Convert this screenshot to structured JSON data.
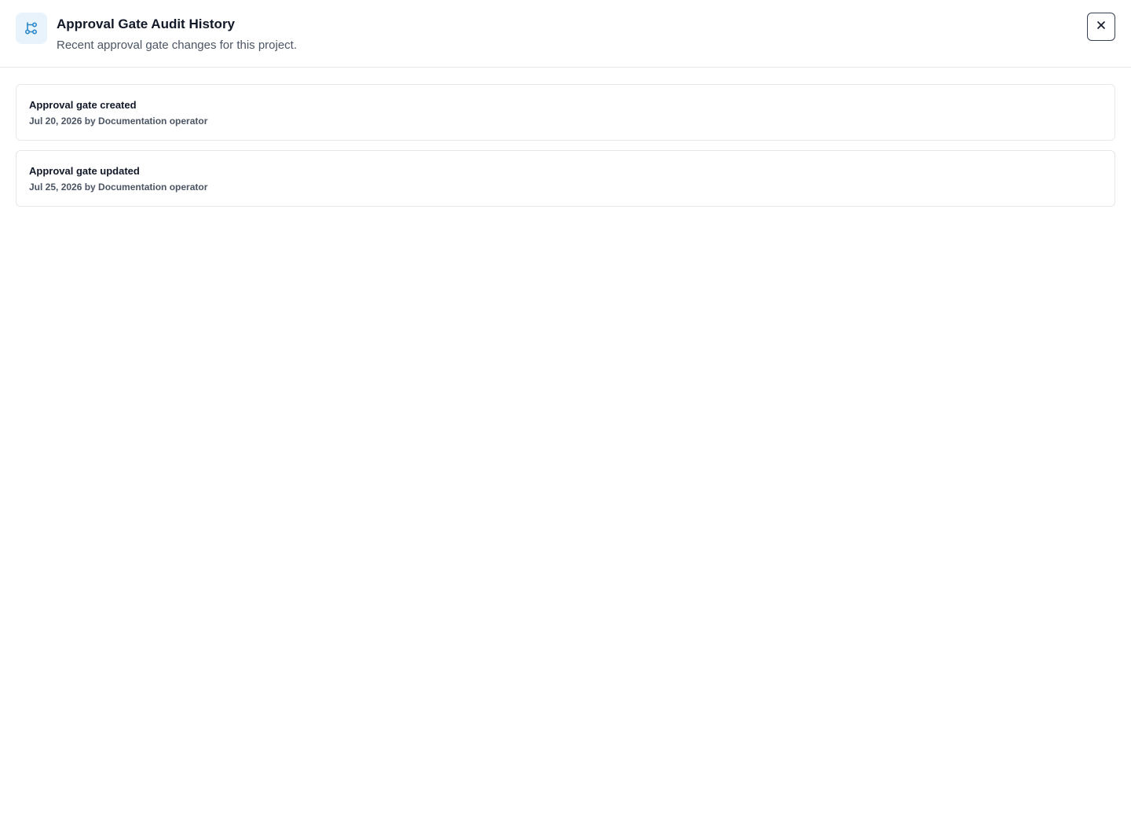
{
  "header": {
    "icon": "workflow-branch-icon",
    "title": "Approval Gate Audit History",
    "subtitle": "Recent approval gate changes for this project.",
    "close_icon": "close-icon"
  },
  "audit_entries": [
    {
      "title": "Approval gate created",
      "meta": "Jul 20, 2026 by Documentation operator"
    },
    {
      "title": "Approval gate updated",
      "meta": "Jul 25, 2026 by Documentation operator"
    }
  ],
  "colors": {
    "accent": "#2b88c8",
    "icon_background": "#e8f3fb",
    "border": "#e5e7eb",
    "muted_text": "#4b5563"
  }
}
